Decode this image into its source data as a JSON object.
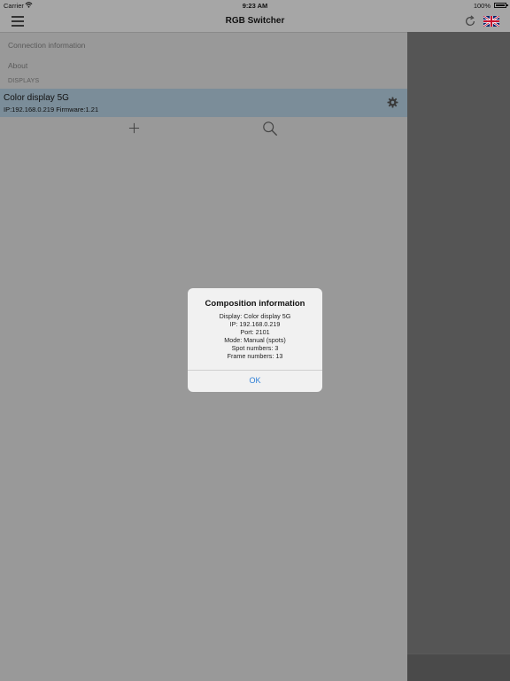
{
  "status_bar": {
    "carrier": "Carrier",
    "time": "9:23 AM",
    "battery": "100%"
  },
  "navbar": {
    "title": "RGB Switcher",
    "menu_icon": "hamburger-icon",
    "refresh_icon": "refresh-icon",
    "language_icon": "uk-flag-icon"
  },
  "sidebar": {
    "items": [
      {
        "label": "Connection information"
      },
      {
        "label": "About"
      }
    ],
    "section_header": "DISPLAYS",
    "displays": [
      {
        "name": "Color display 5G",
        "detail": "IP:192.168.0.219 Firmware:1.21"
      }
    ],
    "add_icon": "plus-icon",
    "search_icon": "search-icon"
  },
  "alert": {
    "title": "Composition information",
    "lines": [
      "Display: Color display 5G",
      "IP: 192.168.0.219",
      "Port: 2101",
      "Mode: Manual (spots)",
      "Spot numbers: 3",
      "Frame numbers: 13"
    ],
    "ok_label": "OK"
  },
  "colors": {
    "accent": "#2f7fd6",
    "selected_row": "#7b8d99",
    "dimmed_background": "#999999",
    "right_panel": "#555555"
  }
}
